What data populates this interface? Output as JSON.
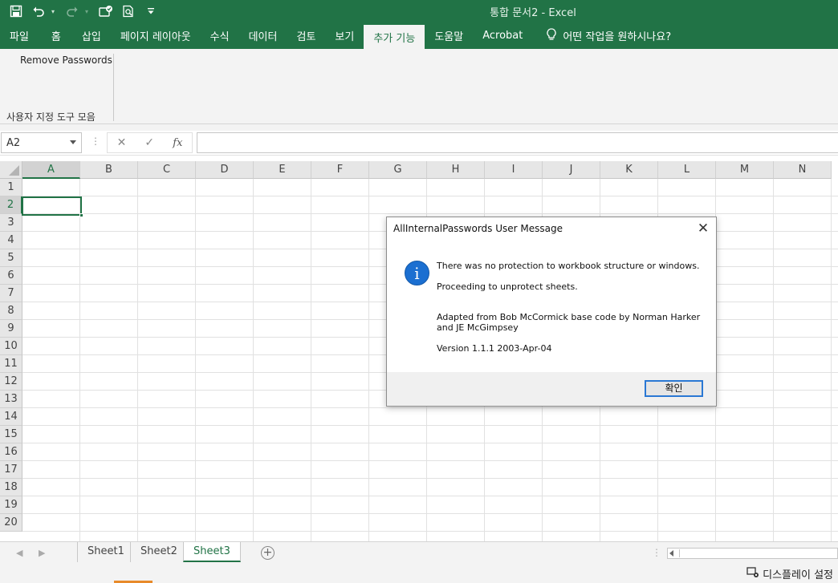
{
  "window": {
    "title": "통합 문서2  -  Excel",
    "quick_access": [
      "save-icon",
      "undo-icon",
      "redo-icon",
      "touch-mode-icon",
      "print-preview-icon",
      "customize-qat-icon"
    ]
  },
  "ribbon": {
    "tabs": [
      "파일",
      "홈",
      "삽입",
      "페이지 레이아웃",
      "수식",
      "데이터",
      "검토",
      "보기",
      "추가 기능",
      "도움말",
      "Acrobat"
    ],
    "active_tab": "추가 기능",
    "tell_me": "어떤 작업을 원하시나요?",
    "command": "Remove Passwords",
    "group_label": "사용자 지정 도구 모음"
  },
  "formula_bar": {
    "name_box": "A2",
    "fx_label": "fx",
    "formula": ""
  },
  "grid": {
    "columns": [
      "A",
      "B",
      "C",
      "D",
      "E",
      "F",
      "G",
      "H",
      "I",
      "J",
      "K",
      "L",
      "M",
      "N"
    ],
    "rows": [
      "1",
      "2",
      "3",
      "4",
      "5",
      "6",
      "7",
      "8",
      "9",
      "10",
      "11",
      "12",
      "13",
      "14",
      "15",
      "16",
      "17",
      "18",
      "19",
      "20"
    ],
    "active_cell": "A2"
  },
  "sheets": {
    "tabs": [
      "Sheet1",
      "Sheet2",
      "Sheet3"
    ],
    "active": "Sheet3"
  },
  "status": {
    "display_settings": "디스플레이 설정"
  },
  "dialog": {
    "title": "AllInternalPasswords User Message",
    "line1": "There was no protection to workbook structure or windows.",
    "line2": "Proceeding to unprotect sheets.",
    "line3a": "Adapted from Bob McCormick base code by Norman Harker",
    "line3b": "and JE McGimpsey",
    "line4": "Version 1.1.1 2003-Apr-04",
    "ok_label": "확인"
  },
  "colors": {
    "excel_green": "#217346",
    "info_blue": "#1b6fd1"
  }
}
